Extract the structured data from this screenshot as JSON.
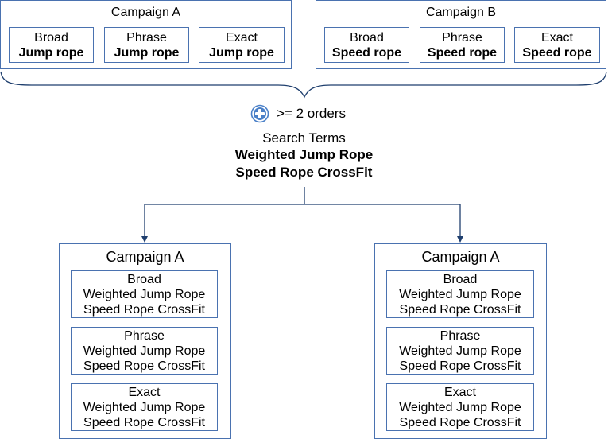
{
  "colors": {
    "box_border": "#4a72b0",
    "connector": "#1f3f6e",
    "plus_icon": "#4a80c8"
  },
  "top_campaigns": [
    {
      "title": "Campaign A",
      "groups": [
        {
          "match": "Broad",
          "keyword": "Jump rope"
        },
        {
          "match": "Phrase",
          "keyword": "Jump rope"
        },
        {
          "match": "Exact",
          "keyword": "Jump rope"
        }
      ]
    },
    {
      "title": "Campaign B",
      "groups": [
        {
          "match": "Broad",
          "keyword": "Speed rope"
        },
        {
          "match": "Phrase",
          "keyword": "Speed rope"
        },
        {
          "match": "Exact",
          "keyword": "Speed rope"
        }
      ]
    }
  ],
  "condition": {
    "icon": "plus-circle-icon",
    "label": ">= 2 orders"
  },
  "search_terms": {
    "heading": "Search Terms",
    "terms": [
      "Weighted Jump Rope",
      "Speed Rope CrossFit"
    ]
  },
  "bottom_campaigns": [
    {
      "title": "Campaign A",
      "groups": [
        {
          "match": "Broad",
          "terms": [
            "Weighted Jump Rope",
            "Speed Rope CrossFit"
          ]
        },
        {
          "match": "Phrase",
          "terms": [
            "Weighted Jump Rope",
            "Speed Rope CrossFit"
          ]
        },
        {
          "match": "Exact",
          "terms": [
            "Weighted Jump Rope",
            "Speed Rope CrossFit"
          ]
        }
      ]
    },
    {
      "title": "Campaign A",
      "groups": [
        {
          "match": "Broad",
          "terms": [
            "Weighted Jump Rope",
            "Speed Rope CrossFit"
          ]
        },
        {
          "match": "Phrase",
          "terms": [
            "Weighted Jump Rope",
            "Speed Rope CrossFit"
          ]
        },
        {
          "match": "Exact",
          "terms": [
            "Weighted Jump Rope",
            "Speed Rope CrossFit"
          ]
        }
      ]
    }
  ]
}
